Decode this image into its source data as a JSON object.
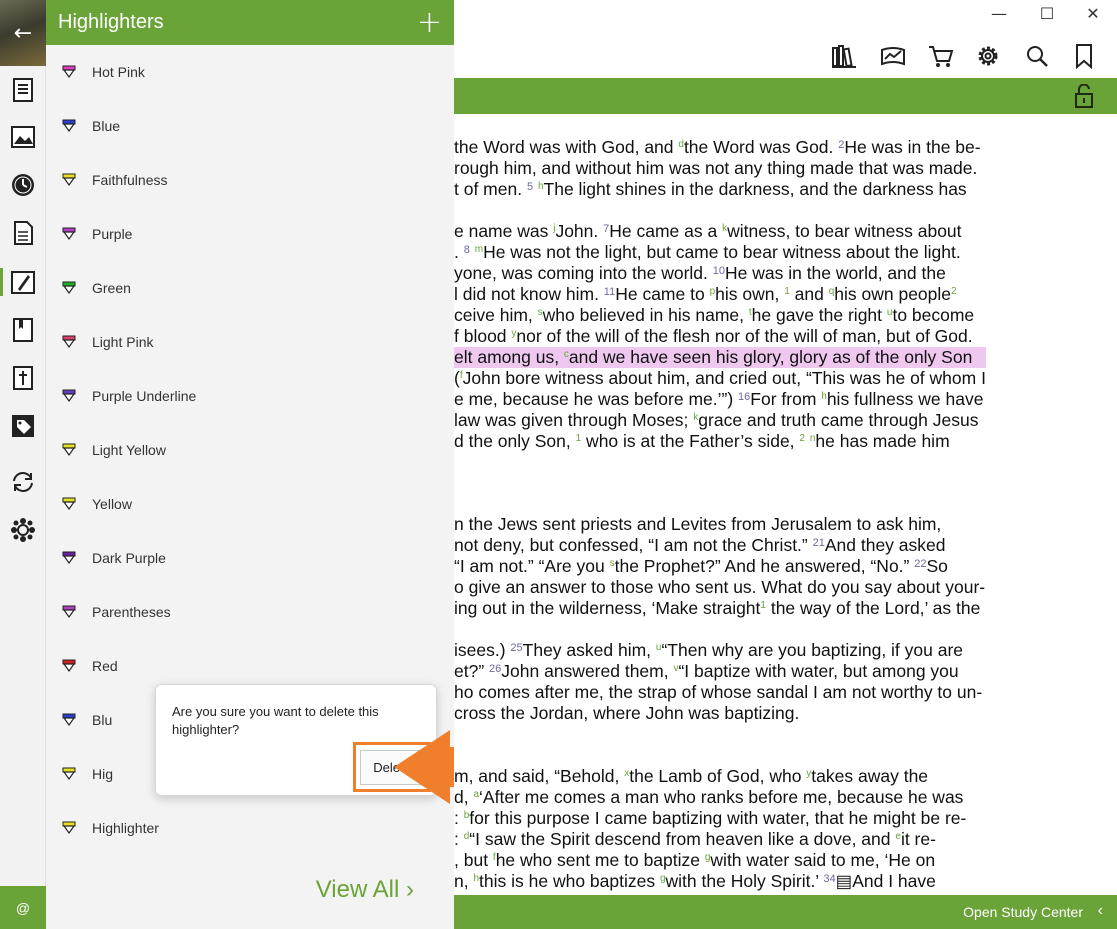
{
  "panel": {
    "title": "Highlighters",
    "add_icon": "plus-icon",
    "items": [
      {
        "label": "Hot Pink",
        "color": "#e040c0"
      },
      {
        "label": "Blue",
        "color": "#2a3fd0"
      },
      {
        "label": "Faithfulness",
        "color": "#e8e020"
      },
      {
        "label": "Purple",
        "color": "#b040c8"
      },
      {
        "label": "Green",
        "color": "#20b020"
      },
      {
        "label": "Light Pink",
        "color": "#e04070"
      },
      {
        "label": "Purple Underline",
        "color": "#6040c0"
      },
      {
        "label": "Light Yellow",
        "color": "#e8e020"
      },
      {
        "label": "Yellow",
        "color": "#e8e020"
      },
      {
        "label": "Dark Purple",
        "color": "#6a20a0"
      },
      {
        "label": "Parentheses",
        "color": "#b040c8"
      },
      {
        "label": "Red",
        "color": "#d02020"
      },
      {
        "label": "Blu",
        "color": "#2a3fd0"
      },
      {
        "label": "Hig",
        "color": "#e8e020"
      },
      {
        "label": "Highlighter",
        "color": "#e8e020"
      }
    ],
    "view_all": "View All ›"
  },
  "confirm": {
    "message": "Are you sure you want to delete this highlighter?",
    "delete_label": "Delete"
  },
  "window": {
    "minimize": "—",
    "maximize": "☐",
    "close": "✕"
  },
  "footer": {
    "open_study_center": "Open Study Center",
    "chevron": "‹"
  },
  "rail": {
    "at_label": "@"
  },
  "colors": {
    "accent": "#6aa338",
    "annotation": "#f07e2a",
    "highlight": "#efc8f0"
  }
}
